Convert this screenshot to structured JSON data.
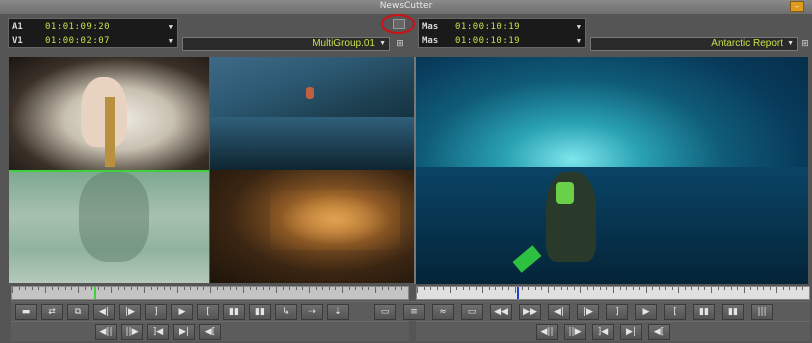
{
  "window": {
    "title": "NewsCutter"
  },
  "source": {
    "rows": [
      {
        "label": "A1",
        "timecode": "01:01:09:20"
      },
      {
        "label": "V1",
        "timecode": "01:00:02:07"
      }
    ],
    "sequence": "MultiGroup.01"
  },
  "record": {
    "rows": [
      {
        "label": "Mas",
        "timecode": "01:00:10:19"
      },
      {
        "label": "Mas",
        "timecode": "01:00:10:19"
      }
    ],
    "sequence": "Antarctic Report"
  },
  "accent": {
    "timecode": "#c8e04a",
    "highlight_ring": "#d01010",
    "active_angle": "#3fd03f"
  },
  "icons": {
    "left_row1": [
      "mark-clip-icon",
      "trim-icon",
      "overwrite-icon",
      "step-back-icon",
      "step-forward-icon",
      "mark-out-icon",
      "play-icon",
      "mark-in-icon",
      "match-frame-icon",
      "splice-icon",
      "lift-icon",
      "extract-icon",
      "video-quality-icon"
    ],
    "left_row2": [
      "step-back-10-icon",
      "step-forward-10-icon",
      "play-in-out-icon",
      "go-to-out-icon",
      "clear-in-icon"
    ],
    "right_row1": [
      "toggle-source-icon",
      "audio-icon",
      "sync-icon",
      "rewind-icon",
      "fast-forward-icon",
      "step-back-icon",
      "step-forward-icon",
      "mark-out-icon",
      "play-icon",
      "mark-in-icon",
      "match-frame-icon",
      "splice-icon",
      "lift-icon",
      "extract-icon"
    ],
    "right_row2": [
      "step-back-10-icon",
      "step-forward-10-icon",
      "play-in-out-icon",
      "go-to-out-icon",
      "clear-in-icon"
    ]
  },
  "glyphs": {
    "left_row1": [
      "▬",
      "⇄",
      "⧉",
      "◀|",
      "|▶",
      "⁆",
      "▶",
      "[",
      "▮▮",
      "▮▮",
      "↳",
      "⇢",
      "⇣"
    ],
    "left_row2": [
      "◀||",
      "||▶",
      "]◀",
      "▶|",
      "◀["
    ],
    "right_row1": [
      "▭",
      "≡",
      "≈",
      "▭",
      "◀◀",
      "▶▶",
      "◀|",
      "|▶",
      "]",
      "▶",
      "[",
      "▮▮",
      "▮▮",
      "|||",
      "≡"
    ],
    "right_row2": [
      "◀||",
      "||▶",
      "]◀",
      "▶|",
      "◀["
    ]
  }
}
